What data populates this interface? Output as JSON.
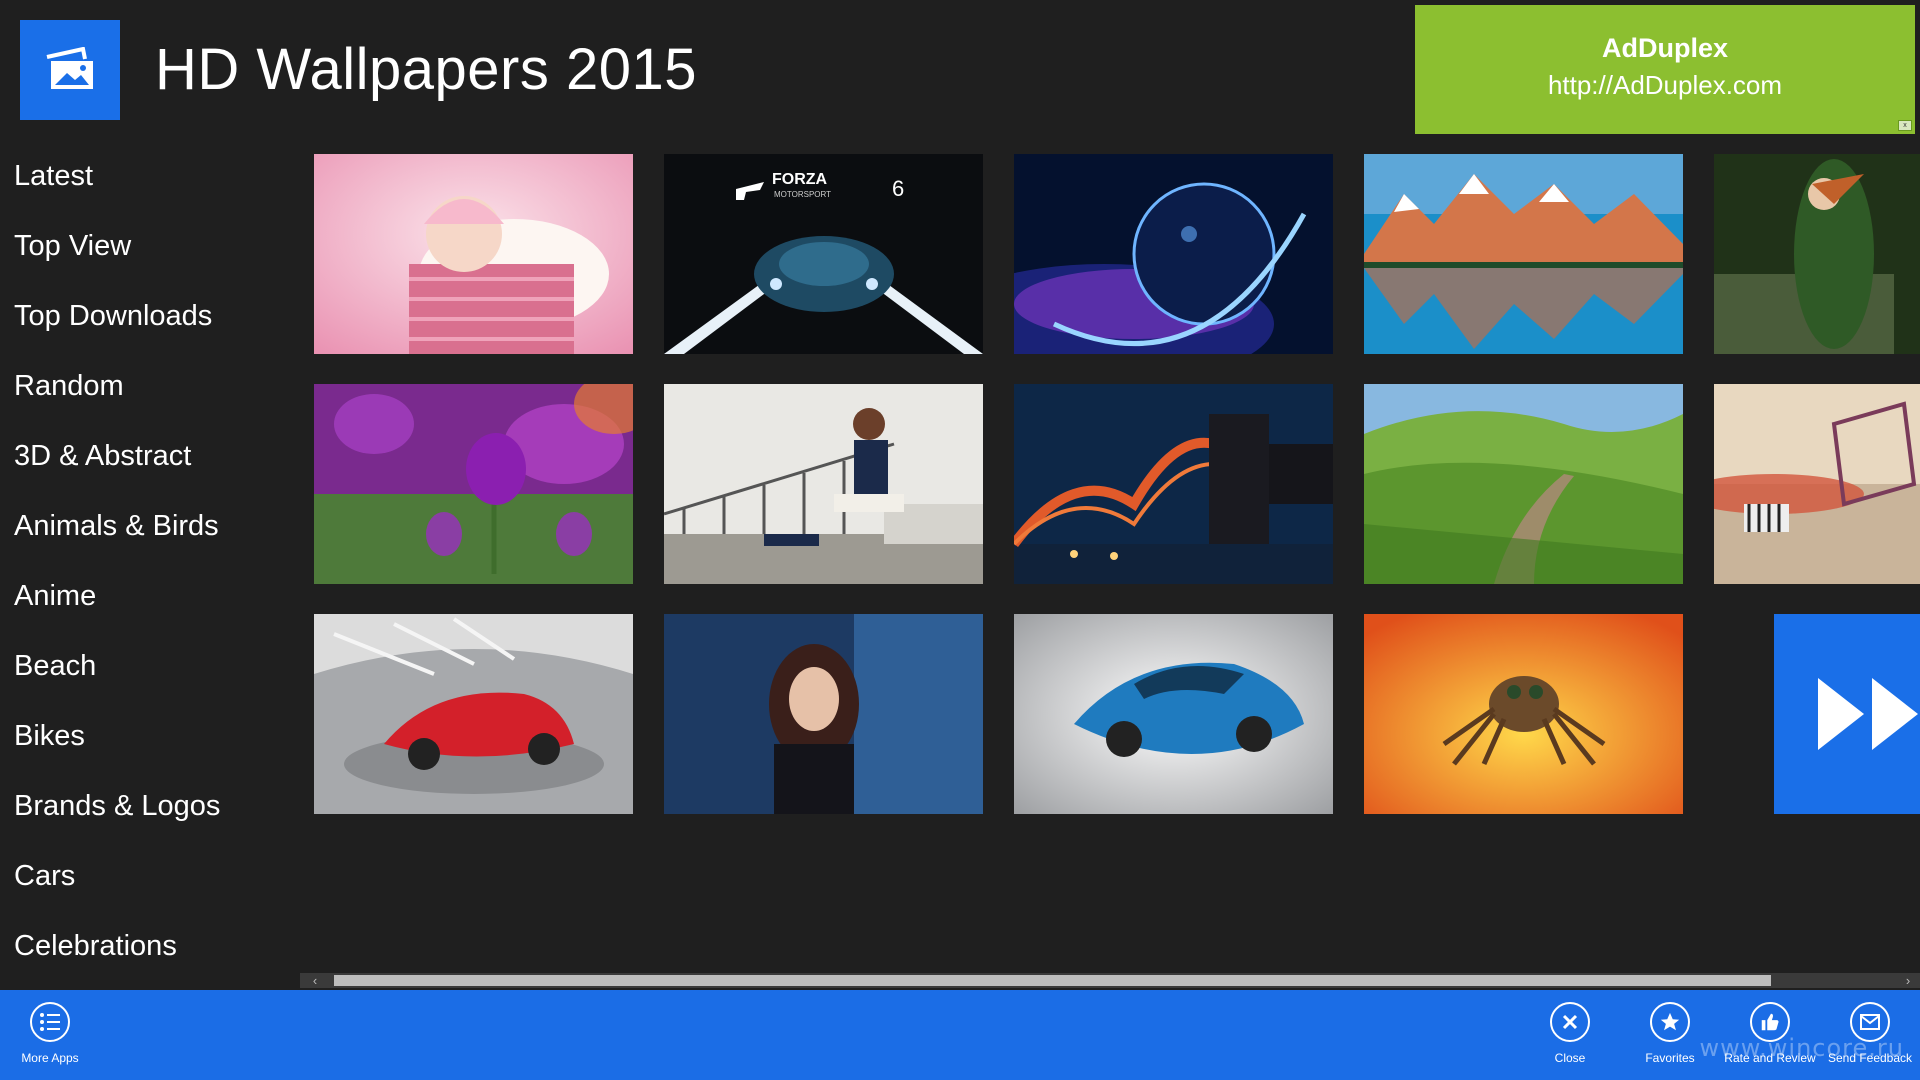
{
  "app": {
    "title": "HD Wallpapers 2015",
    "logo_icon": "picture-icon",
    "accent": "#1a6fe8"
  },
  "ad": {
    "title": "AdDuplex",
    "url": "http://AdDuplex.com",
    "color": "#8cbf30",
    "corner_mark": "x"
  },
  "sidebar": {
    "items": [
      {
        "label": "Latest"
      },
      {
        "label": "Top View"
      },
      {
        "label": "Top Downloads"
      },
      {
        "label": "Random"
      },
      {
        "label": "3D & Abstract"
      },
      {
        "label": "Animals & Birds"
      },
      {
        "label": "Anime"
      },
      {
        "label": "Beach"
      },
      {
        "label": "Bikes"
      },
      {
        "label": "Brands & Logos"
      },
      {
        "label": "Cars"
      },
      {
        "label": "Celebrations"
      }
    ]
  },
  "gallery": {
    "tiles": [
      {
        "subject": "baby-in-basket"
      },
      {
        "subject": "forza-motorsport-6",
        "text_brand": "FORZA",
        "text_sub": "MOTORSPORT",
        "text_num": "6"
      },
      {
        "subject": "space-planet"
      },
      {
        "subject": "mountain-lake"
      },
      {
        "subject": "archer"
      },
      {
        "subject": "purple-tulips"
      },
      {
        "subject": "woman-on-bench"
      },
      {
        "subject": "bridge-at-night"
      },
      {
        "subject": "green-hills-path"
      },
      {
        "subject": "surreal-desert-zebra"
      },
      {
        "subject": "red-sports-car"
      },
      {
        "subject": "woman-portrait"
      },
      {
        "subject": "blue-sports-car"
      },
      {
        "subject": "jumping-spider"
      }
    ],
    "more_icon": "fast-forward-icon"
  },
  "scrollbar": {
    "left_arrow": "‹",
    "right_arrow": "›"
  },
  "appbar": {
    "color": "#1b6de6",
    "left": [
      {
        "label": "More Apps",
        "icon": "list-icon"
      }
    ],
    "right": [
      {
        "label": "Close",
        "icon": "close-icon"
      },
      {
        "label": "Favorites",
        "icon": "star-icon"
      },
      {
        "label": "Rate and Review",
        "icon": "thumbs-up-icon"
      },
      {
        "label": "Send Feedback",
        "icon": "mail-icon"
      }
    ]
  },
  "watermark": "www.wincore.ru"
}
